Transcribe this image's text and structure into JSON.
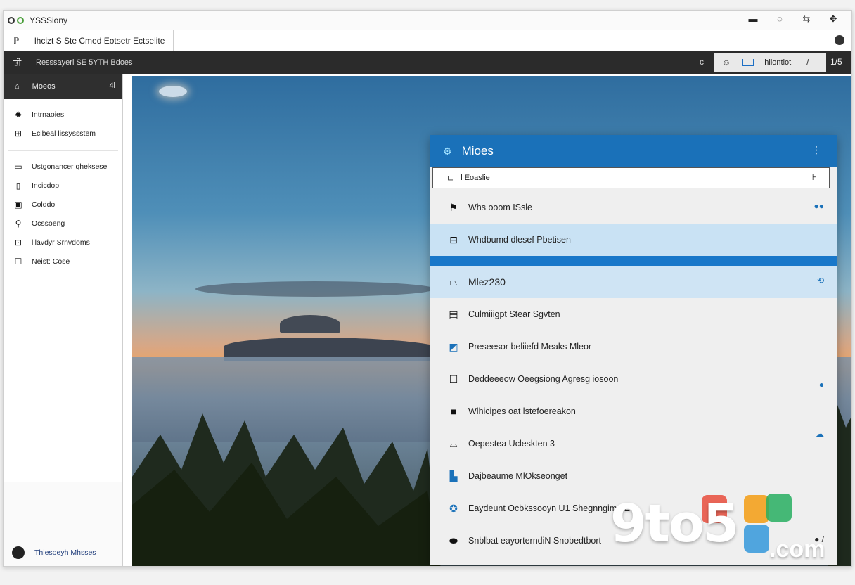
{
  "window": {
    "title": "YSSSiony"
  },
  "titlebar": {
    "controls": [
      "minimize",
      "restore",
      "maximize",
      "close"
    ]
  },
  "tab": {
    "label": "lhcizt S Ste Cmed Eotsetr Ectselite"
  },
  "toolbar": {
    "left_label": "ਤੀ",
    "label": "Resssayeri SE 5YTH Bdoes",
    "c_label": "c",
    "pill_text": "hllontiot",
    "pill_end": "/",
    "right_label": "1/5"
  },
  "sidebar": {
    "header": {
      "label": "Moeos",
      "right": "4l"
    },
    "items": [
      {
        "label": "Intrnaoies",
        "icon": "gear-icon"
      },
      {
        "label": "Ecibeal lissyssstem",
        "icon": "grid-icon"
      },
      {
        "label": "Ustgonancer qheksese",
        "icon": "monitor-icon"
      },
      {
        "label": "Incicdop",
        "icon": "doc-icon"
      },
      {
        "label": "Colddo",
        "icon": "device-icon"
      },
      {
        "label": "Ocssoeng",
        "icon": "pin-icon"
      },
      {
        "label": "lllavdyr Srnvdoms",
        "icon": "window-icon"
      },
      {
        "label": "Neist: Cose",
        "icon": "square-icon"
      }
    ],
    "footer": {
      "label": "Thlesoeyh Mhsses"
    }
  },
  "panel": {
    "title": "Mioes",
    "search": {
      "value": "l Eoaslie"
    },
    "rows": [
      {
        "label": "Whs ooom ISsle",
        "icon": "flag-icon",
        "state": "normal",
        "right": "●●"
      },
      {
        "label": "Whdbumd dlesef Pbetisen",
        "icon": "drive-icon",
        "state": "hover",
        "right": ""
      },
      {
        "label": "Mlez230",
        "icon": "drive-icon",
        "state": "selected",
        "right": "⟲"
      },
      {
        "label": "Culmiiigpt Stear Sgvten",
        "icon": "doc-icon",
        "state": "normal",
        "right": ""
      },
      {
        "label": "Preseesor beliiefd Meaks Mleor",
        "icon": "pen-icon",
        "state": "normal",
        "right": ""
      },
      {
        "label": "Deddeeeow Oeegsiong Agresg iosoon",
        "icon": "square-icon",
        "state": "normal",
        "right": "●"
      },
      {
        "label": "Wlhicipes oat lstefoereakon",
        "icon": "black-square-icon",
        "state": "normal",
        "right": ""
      },
      {
        "label": "Oepestea Ucleskten 3",
        "icon": "cloud-icon",
        "state": "normal",
        "right": "☁"
      },
      {
        "label": "Dajbeaume MlOkseonget",
        "icon": "folder-icon",
        "state": "normal",
        "right": ""
      },
      {
        "label": "Eaydeunt Ocbkssooyn U1 Shegnngimn ES",
        "icon": "compass-icon",
        "state": "normal",
        "right": ""
      },
      {
        "label": "Snblbat eayorterndiN Snobedtbort",
        "icon": "toggle-icon",
        "state": "normal",
        "right": "● /"
      }
    ]
  },
  "watermark": {
    "text": "9to5",
    "suffix": ".com",
    "colors": [
      "#e74c3c",
      "#f39c12",
      "#27ae60",
      "#3498db"
    ]
  }
}
